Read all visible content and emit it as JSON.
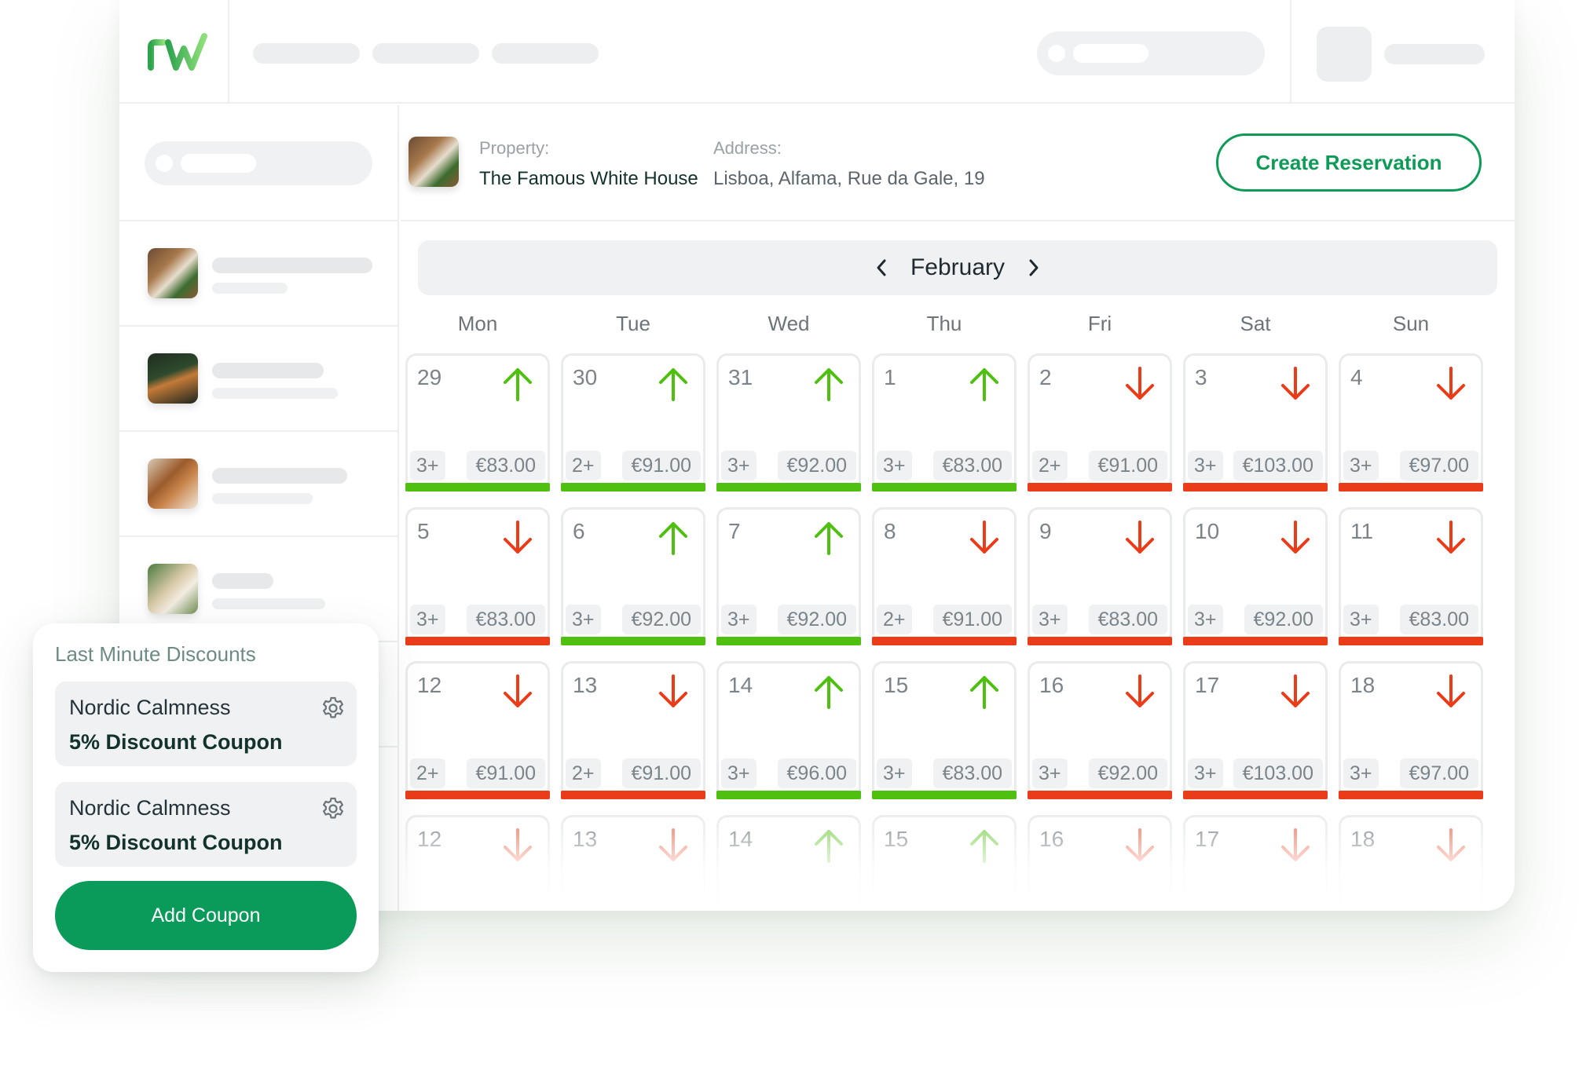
{
  "colors": {
    "brand": "#0a9a5a",
    "up": "#4fbf10",
    "down": "#ea3c18",
    "text_dark": "#13322b"
  },
  "logo": {
    "text": "rw"
  },
  "property": {
    "label": "Property:",
    "name": "The Famous White House",
    "address_label": "Address:",
    "address": "Lisboa, Alfama, Rue da Gale, 19"
  },
  "actions": {
    "create_reservation": "Create Reservation"
  },
  "calendar": {
    "month": "February",
    "weekdays": [
      "Mon",
      "Tue",
      "Wed",
      "Thu",
      "Fri",
      "Sat",
      "Sun"
    ],
    "weeks": [
      [
        {
          "day": "29",
          "trend": "up",
          "min_stay": "3+",
          "price": "€83.00"
        },
        {
          "day": "30",
          "trend": "up",
          "min_stay": "2+",
          "price": "€91.00"
        },
        {
          "day": "31",
          "trend": "up",
          "min_stay": "3+",
          "price": "€92.00"
        },
        {
          "day": "1",
          "trend": "up",
          "min_stay": "3+",
          "price": "€83.00"
        },
        {
          "day": "2",
          "trend": "down",
          "min_stay": "2+",
          "price": "€91.00"
        },
        {
          "day": "3",
          "trend": "down",
          "min_stay": "3+",
          "price": "€103.00"
        },
        {
          "day": "4",
          "trend": "down",
          "min_stay": "3+",
          "price": "€97.00"
        }
      ],
      [
        {
          "day": "5",
          "trend": "down",
          "min_stay": "3+",
          "price": "€83.00"
        },
        {
          "day": "6",
          "trend": "up",
          "min_stay": "3+",
          "price": "€92.00"
        },
        {
          "day": "7",
          "trend": "up",
          "min_stay": "3+",
          "price": "€92.00"
        },
        {
          "day": "8",
          "trend": "down",
          "min_stay": "2+",
          "price": "€91.00"
        },
        {
          "day": "9",
          "trend": "down",
          "min_stay": "3+",
          "price": "€83.00"
        },
        {
          "day": "10",
          "trend": "down",
          "min_stay": "3+",
          "price": "€92.00"
        },
        {
          "day": "11",
          "trend": "down",
          "min_stay": "3+",
          "price": "€83.00"
        }
      ],
      [
        {
          "day": "12",
          "trend": "down",
          "min_stay": "2+",
          "price": "€91.00"
        },
        {
          "day": "13",
          "trend": "down",
          "min_stay": "2+",
          "price": "€91.00"
        },
        {
          "day": "14",
          "trend": "up",
          "min_stay": "3+",
          "price": "€96.00"
        },
        {
          "day": "15",
          "trend": "up",
          "min_stay": "3+",
          "price": "€83.00"
        },
        {
          "day": "16",
          "trend": "down",
          "min_stay": "3+",
          "price": "€92.00"
        },
        {
          "day": "17",
          "trend": "down",
          "min_stay": "3+",
          "price": "€103.00"
        },
        {
          "day": "18",
          "trend": "down",
          "min_stay": "3+",
          "price": "€97.00"
        }
      ],
      [
        {
          "day": "12",
          "trend": "down"
        },
        {
          "day": "13",
          "trend": "down"
        },
        {
          "day": "14",
          "trend": "up"
        },
        {
          "day": "15",
          "trend": "up"
        },
        {
          "day": "16",
          "trend": "down"
        },
        {
          "day": "17",
          "trend": "down"
        },
        {
          "day": "18",
          "trend": "down"
        }
      ]
    ]
  },
  "discounts": {
    "title": "Last Minute Discounts",
    "coupons": [
      {
        "name": "Nordic Calmness",
        "description": "5% Discount Coupon"
      },
      {
        "name": "Nordic Calmness",
        "description": "5% Discount Coupon"
      }
    ],
    "add_label": "Add Coupon"
  }
}
